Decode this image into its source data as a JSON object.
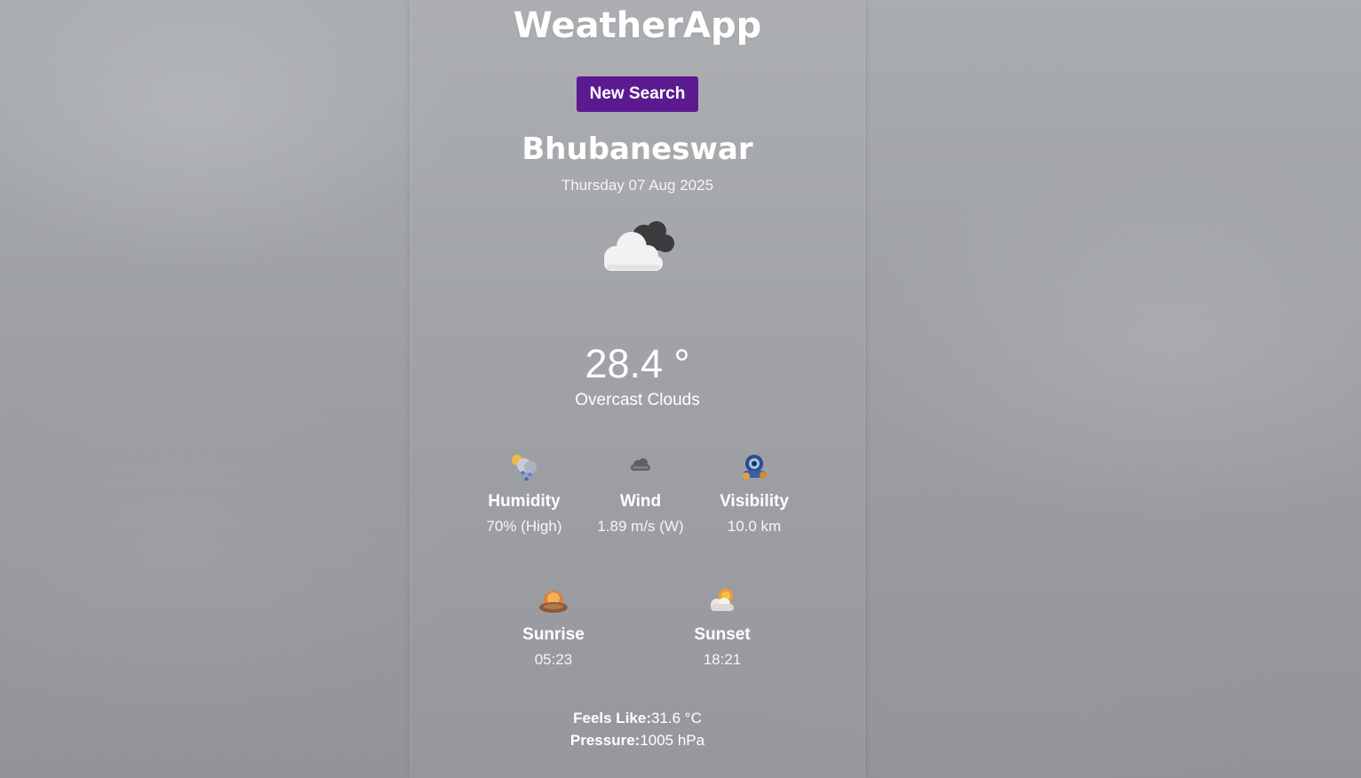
{
  "app": {
    "title": "WeatherApp"
  },
  "toolbar": {
    "new_search_label": "New Search"
  },
  "location": {
    "city": "Bhubaneswar",
    "date": "Thursday 07 Aug 2025"
  },
  "current": {
    "icon": "overcast-clouds-icon",
    "temperature": "28.4 °",
    "condition": "Overcast Clouds"
  },
  "stats": [
    {
      "icon": "humidity-icon",
      "label": "Humidity",
      "value": "70% (High)"
    },
    {
      "icon": "wind-icon",
      "label": "Wind",
      "value": "1.89 m/s (W)"
    },
    {
      "icon": "visibility-icon",
      "label": "Visibility",
      "value": "10.0 km"
    }
  ],
  "sun": [
    {
      "icon": "sunrise-icon",
      "label": "Sunrise",
      "value": "05:23"
    },
    {
      "icon": "sunset-icon",
      "label": "Sunset",
      "value": "18:21"
    }
  ],
  "details": {
    "feels_like_label": "Feels Like:",
    "feels_like_value": "31.6 °C",
    "pressure_label": "Pressure:",
    "pressure_value": "1005 hPa"
  },
  "colors": {
    "button_bg": "#5b1a8f",
    "text": "#ffffff",
    "background": "#9d9fa4"
  }
}
